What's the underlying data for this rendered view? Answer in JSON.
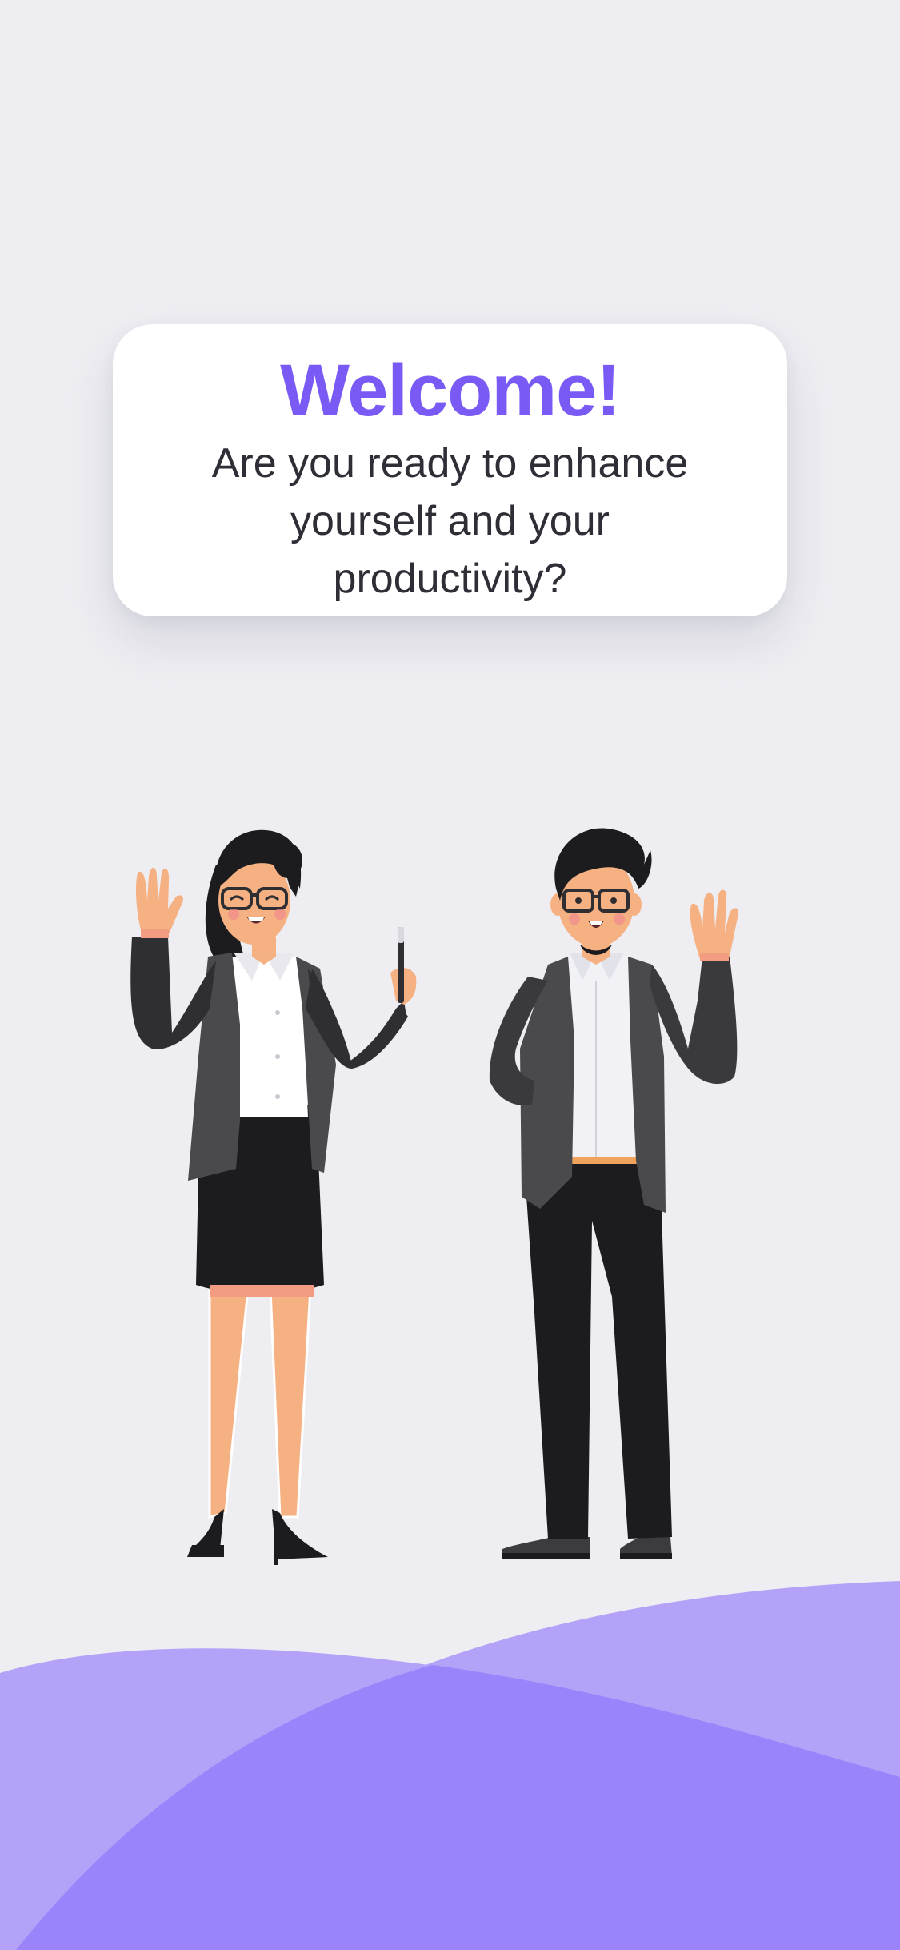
{
  "welcome": {
    "title": "Welcome!",
    "subtitle": "Are you ready to enhance yourself and your productivity?"
  },
  "colors": {
    "background": "#ededf2",
    "accent": "#7a5af5",
    "wave_light": "#b3a2f7",
    "wave_dark": "#9b83fb",
    "card": "#ffffff",
    "text": "#2e2e36"
  },
  "illustration": {
    "figures": [
      "woman-waving-with-pen",
      "man-waving"
    ]
  }
}
